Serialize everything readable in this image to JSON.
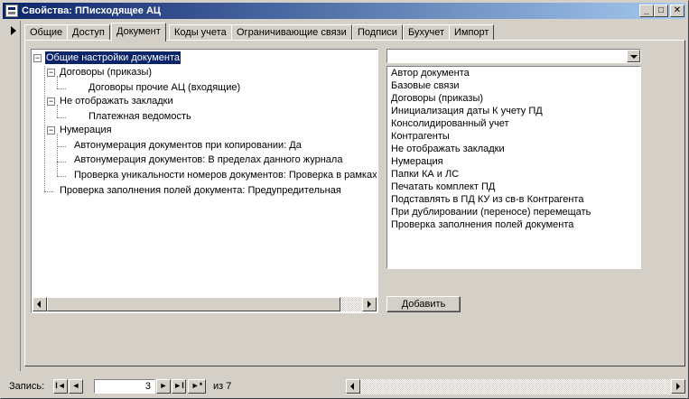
{
  "window": {
    "title": "Свойства: ППисходящее АЦ",
    "minimize": "_",
    "maximize": "□",
    "close": "✕"
  },
  "tabs": [
    {
      "label": "Общие"
    },
    {
      "label": "Доступ"
    },
    {
      "label": "Документ",
      "active": true
    },
    {
      "label": "Коды учета"
    },
    {
      "label": "Ограничивающие связи"
    },
    {
      "label": "Подписи"
    },
    {
      "label": "Бухучет"
    },
    {
      "label": "Импорт"
    }
  ],
  "tree": {
    "nodes": [
      {
        "label": "Общие настройки документа",
        "level": 0,
        "expander": "−",
        "selected": true
      },
      {
        "label": "Договоры (приказы)",
        "level": 1,
        "expander": "−"
      },
      {
        "label": "Договоры прочие АЦ (входящие)",
        "level": 2
      },
      {
        "label": "Не отображать закладки",
        "level": 1,
        "expander": "−"
      },
      {
        "label": "Платежная ведомость",
        "level": 2
      },
      {
        "label": "Нумерация",
        "level": 1,
        "expander": "−"
      },
      {
        "label": "Автонумерация документов при копировании: Да",
        "level": 2
      },
      {
        "label": "Автонумерация документов: В пределах данного журнала",
        "level": 2
      },
      {
        "label": "Проверка уникальности номеров документов: Проверка в рамках",
        "level": 2
      },
      {
        "label": "Проверка заполнения полей документа: Предупредительная",
        "level": 1
      }
    ]
  },
  "combo": {
    "value": ""
  },
  "list": {
    "items": [
      "Автор документа",
      "Базовые связи",
      "Договоры (приказы)",
      "Инициализация даты К учету ПД",
      "Консолидированный учет",
      "Контрагенты",
      "Не отображать закладки",
      "Нумерация",
      "Папки КА и  ЛС",
      "Печатать комплект ПД",
      "Подставлять в ПД КУ из св-в Контрагента",
      "При дублировании (переносе) перемещать",
      "Проверка заполнения полей документа"
    ]
  },
  "buttons": {
    "add": "Добавить"
  },
  "navigation": {
    "label": "Запись:",
    "first": "I◄",
    "prev": "◄",
    "current": "3",
    "next": "►",
    "last": "►I",
    "new": "►*",
    "of_text": "из  7"
  }
}
